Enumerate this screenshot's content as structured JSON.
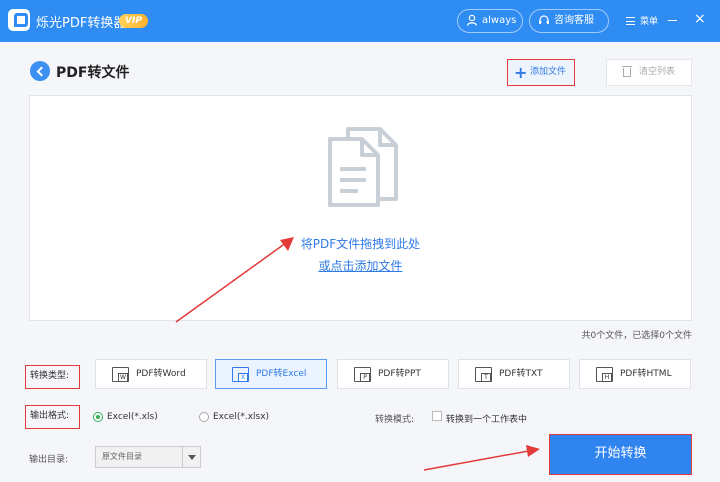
{
  "titlebar": {
    "app_name": "烁光PDF转换器",
    "vip": "VIP",
    "user": "always",
    "service": "咨询客服",
    "menu": "菜单",
    "close": "×"
  },
  "header": {
    "title": "PDF转文件",
    "add_file": "添加文件",
    "clear_list": "清空列表"
  },
  "drop_zone": {
    "line1": "将PDF文件拖拽到此处",
    "line2": "或点击添加文件"
  },
  "file_count": "共0个文件，已选择0个文件",
  "convert_type": {
    "label": "转换类型:",
    "options": [
      {
        "label": "PDF转Word",
        "tag": "W",
        "active": false
      },
      {
        "label": "PDF转Excel",
        "tag": "X",
        "active": true
      },
      {
        "label": "PDF转PPT",
        "tag": "P",
        "active": false
      },
      {
        "label": "PDF转TXT",
        "tag": "T",
        "active": false
      },
      {
        "label": "PDF转HTML",
        "tag": "H",
        "active": false
      }
    ]
  },
  "output_format": {
    "label": "输出格式:",
    "options": [
      {
        "label": "Excel(*.xls)",
        "checked": true
      },
      {
        "label": "Excel(*.xlsx)",
        "checked": false
      }
    ]
  },
  "convert_mode": {
    "label": "转换模式:",
    "checkbox": "转换到一个工作表中",
    "checked": false
  },
  "output_dir": {
    "label": "输出目录:",
    "value": "原文件目录"
  },
  "start_button": "开始转换",
  "colors": {
    "brand": "#2f8cf3",
    "link": "#2f7ae5",
    "highlight_box": "#e33a3a",
    "radio_checked": "#2fae52"
  }
}
